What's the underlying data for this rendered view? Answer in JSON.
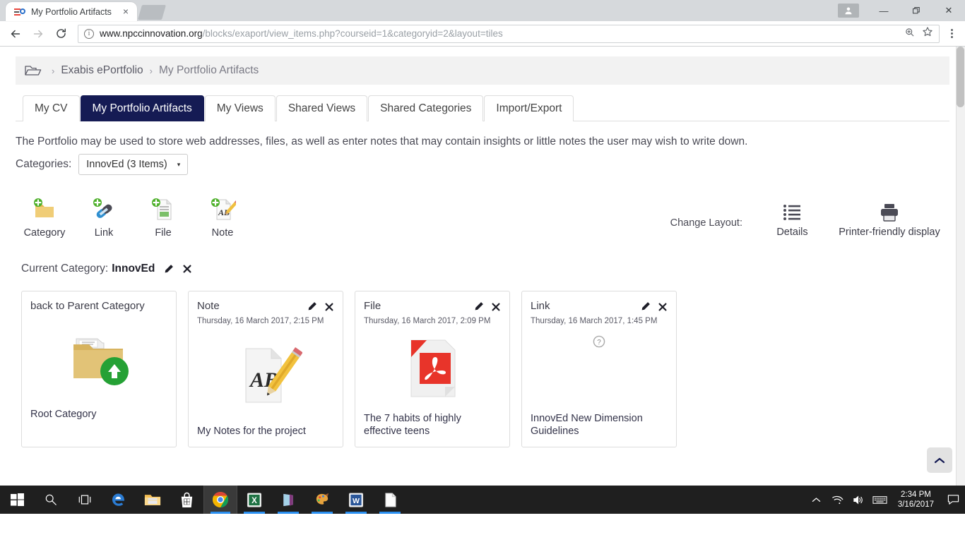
{
  "browser": {
    "tab_title": "My Portfolio Artifacts",
    "tab_close": "×",
    "url_domain": "www.npccinnovation.org",
    "url_path": "/blocks/exaport/view_items.php?courseid=1&categoryid=2&layout=tiles",
    "back_label": "←",
    "forward_label": "→",
    "reload_label": "↻",
    "minimize_label": "—",
    "maximize_label": "❐",
    "close_label": "✕"
  },
  "breadcrumb": {
    "folder_icon": "open-folder-icon",
    "items": [
      "Exabis ePortfolio",
      "My Portfolio Artifacts"
    ],
    "separator": "›"
  },
  "tabs": [
    {
      "label": "My CV",
      "active": false
    },
    {
      "label": "My Portfolio Artifacts",
      "active": true
    },
    {
      "label": "My Views",
      "active": false
    },
    {
      "label": "Shared Views",
      "active": false
    },
    {
      "label": "Shared Categories",
      "active": false
    },
    {
      "label": "Import/Export",
      "active": false
    }
  ],
  "description": "The Portfolio may be used to store web addresses, files, as well as enter notes that may contain insights or little notes the user may wish to write down.",
  "categories": {
    "label": "Categories:",
    "selected": "InnovEd (3 Items)",
    "caret": "▾"
  },
  "add_tools": [
    {
      "label": "Category",
      "icon": "add-category-icon"
    },
    {
      "label": "Link",
      "icon": "add-link-icon"
    },
    {
      "label": "File",
      "icon": "add-file-icon"
    },
    {
      "label": "Note",
      "icon": "add-note-icon"
    }
  ],
  "layout": {
    "label": "Change Layout:",
    "options": [
      {
        "label": "Details",
        "icon": "list-details-icon"
      },
      {
        "label": "Printer-friendly display",
        "icon": "printer-icon"
      }
    ]
  },
  "current_category": {
    "prefix": "Current Category:",
    "name": "InnovEd",
    "edit_icon": "pencil-icon",
    "delete_icon": "close-x-icon"
  },
  "tiles": [
    {
      "type": "back to Parent Category",
      "date": "",
      "caption": "Root Category",
      "icon": "folder-up-icon",
      "has_actions": false
    },
    {
      "type": "Note",
      "date": "Thursday, 16 March 2017, 2:15 PM",
      "caption": "My Notes for the project",
      "icon": "note-ab-pencil-icon",
      "has_actions": true
    },
    {
      "type": "File",
      "date": "Thursday, 16 March 2017, 2:09 PM",
      "caption": "The 7 habits of highly effective teens",
      "icon": "pdf-file-icon",
      "has_actions": true
    },
    {
      "type": "Link",
      "date": "Thursday, 16 March 2017, 1:45 PM",
      "caption": "InnovEd New Dimension Guidelines",
      "icon": "unknown-question-icon",
      "has_actions": true
    }
  ],
  "scroll_top_button": "⌃",
  "taskbar": {
    "items": [
      {
        "name": "start-button",
        "icon": "windows-logo-icon"
      },
      {
        "name": "search-button",
        "icon": "magnifier-icon"
      },
      {
        "name": "task-view-button",
        "icon": "task-view-icon"
      },
      {
        "name": "edge-button",
        "icon": "edge-icon"
      },
      {
        "name": "file-explorer-button",
        "icon": "folder-icon"
      },
      {
        "name": "store-button",
        "icon": "store-bag-icon"
      },
      {
        "name": "chrome-button",
        "icon": "chrome-icon"
      },
      {
        "name": "excel-button",
        "icon": "excel-icon"
      },
      {
        "name": "onenote-button",
        "icon": "onenote-icon"
      },
      {
        "name": "paint-button",
        "icon": "paint-palette-icon"
      },
      {
        "name": "word-button",
        "icon": "word-icon"
      },
      {
        "name": "notepad-button",
        "icon": "notepad-icon"
      }
    ],
    "tray": {
      "show_hidden": "⌃",
      "network_icon": "wifi-icon",
      "volume_icon": "speaker-icon",
      "keyboard_icon": "keyboard-icon",
      "time": "2:34 PM",
      "date": "3/16/2017",
      "action_center_icon": "notification-icon"
    }
  },
  "colors": {
    "active_tab": "#151b54",
    "breadcrumb_bg": "#f2f2f2",
    "taskbar_bg": "#1f1f1f",
    "accent_blue": "#2a8ff0"
  }
}
